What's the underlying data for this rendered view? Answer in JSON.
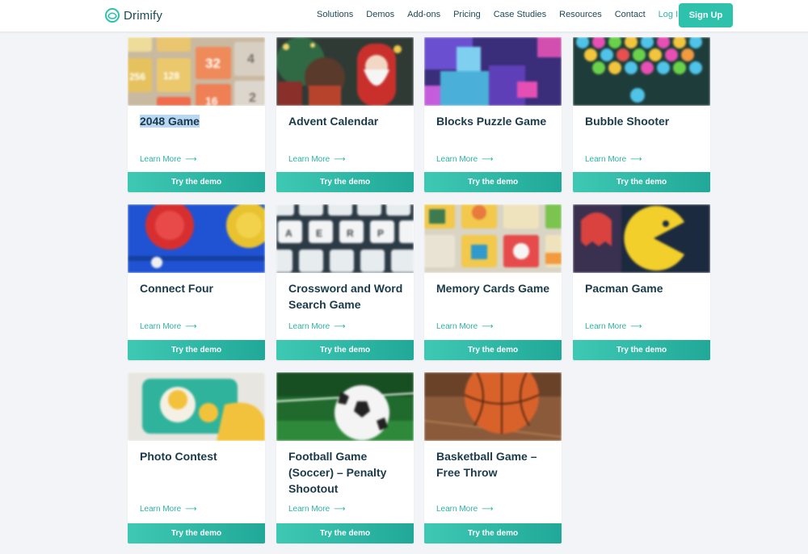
{
  "brand": {
    "name": "Drimify",
    "accent": "#2ec2ad",
    "text_dark": "#1a3a4a"
  },
  "nav": {
    "items": [
      "Solutions",
      "Demos",
      "Add-ons",
      "Pricing",
      "Case Studies",
      "Resources",
      "Contact"
    ],
    "login": "Log In",
    "signup": "Sign Up"
  },
  "cards": [
    {
      "title": "2048 Game",
      "learn": "Learn More",
      "demo": "Try the demo",
      "image_icon": "2048-tiles-image",
      "title_selected": true
    },
    {
      "title": "Advent Calendar",
      "learn": "Learn More",
      "demo": "Try the demo",
      "image_icon": "santa-image"
    },
    {
      "title": "Blocks Puzzle Game",
      "learn": "Learn More",
      "demo": "Try the demo",
      "image_icon": "cubes-image"
    },
    {
      "title": "Bubble Shooter",
      "learn": "Learn More",
      "demo": "Try the demo",
      "image_icon": "bubbles-image"
    },
    {
      "title": "Connect Four",
      "learn": "Learn More",
      "demo": "Try the demo",
      "image_icon": "connect-four-image"
    },
    {
      "title": "Crossword and Word Search Game",
      "learn": "Learn More",
      "demo": "Try the demo",
      "image_icon": "letter-keys-image"
    },
    {
      "title": "Memory Cards Game",
      "learn": "Learn More",
      "demo": "Try the demo",
      "image_icon": "memory-cards-image"
    },
    {
      "title": "Pacman Game",
      "learn": "Learn More",
      "demo": "Try the demo",
      "image_icon": "pacman-image"
    },
    {
      "title": "Photo Contest",
      "learn": "Learn More",
      "demo": "Try the demo",
      "image_icon": "photo-phone-image"
    },
    {
      "title": "Football Game (Soccer) – Penalty Shootout",
      "learn": "Learn More",
      "demo": "Try the demo",
      "image_icon": "soccer-ball-image"
    },
    {
      "title": "Basketball Game – Free Throw",
      "learn": "Learn More",
      "demo": "Try the demo",
      "image_icon": "basketball-image"
    }
  ],
  "tile_2048_numbers": [
    "256",
    "128",
    "32",
    "4",
    "2",
    "16"
  ],
  "key_letters": [
    "A",
    "E",
    "R",
    "P"
  ]
}
